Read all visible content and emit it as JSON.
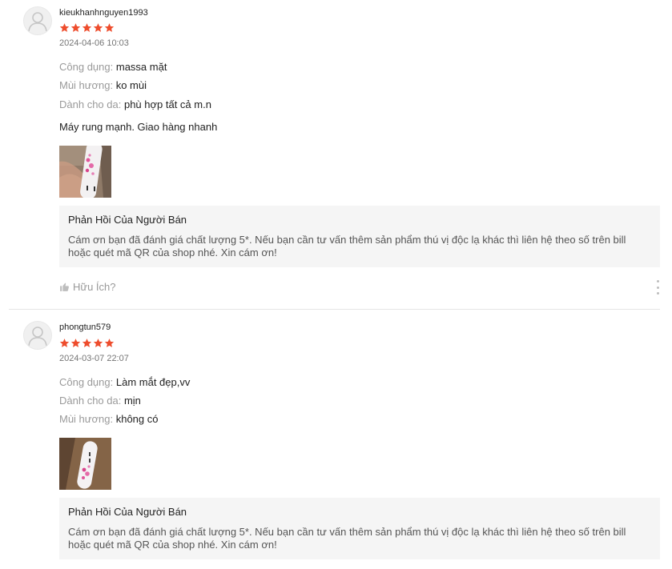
{
  "reviews": [
    {
      "username": "kieukhanhnguyen1993",
      "rating": 5,
      "timestamp": "2024-04-06 10:03",
      "attributes": [
        {
          "key": "Công dụng:",
          "value": "massa mặt"
        },
        {
          "key": "Mùi hương:",
          "value": "ko mùi"
        },
        {
          "key": "Dành cho da:",
          "value": "phù hợp tất cả m.n"
        }
      ],
      "comment": "Máy rung mạnh. Giao hàng nhanh",
      "seller_reply": {
        "title": "Phản Hồi Của Người Bán",
        "body": "Cám ơn bạn đã đánh giá chất lượng 5*. Nếu bạn cần tư vấn thêm sản phẩm thú vị độc lạ khác thì liên hệ theo số trên bill hoặc quét mã QR của shop nhé. Xin cám ơn!"
      },
      "helpful_label": "Hữu Ích?"
    },
    {
      "username": "phongtun579",
      "rating": 5,
      "timestamp": "2024-03-07 22:07",
      "attributes": [
        {
          "key": "Công dụng:",
          "value": "Làm mắt đẹp,vv"
        },
        {
          "key": "Dành cho da:",
          "value": "mịn"
        },
        {
          "key": "Mùi hương:",
          "value": "không có"
        }
      ],
      "seller_reply": {
        "title": "Phản Hồi Của Người Bán",
        "body": "Cám ơn bạn đã đánh giá chất lượng 5*. Nếu bạn cần tư vấn thêm sản phẩm thú vị độc lạ khác thì liên hệ theo số trên bill hoặc quét mã QR của shop nhé. Xin cám ơn!"
      }
    }
  ],
  "colors": {
    "star": "#ee4d2d",
    "muted": "#9a9a9a",
    "reply_bg": "#f5f5f5",
    "divider": "#e5e5e5"
  },
  "icons": {
    "avatar": "user-placeholder-icon",
    "star": "star-icon",
    "helpful": "thumbs-up-icon",
    "more": "more-vertical-icon"
  }
}
